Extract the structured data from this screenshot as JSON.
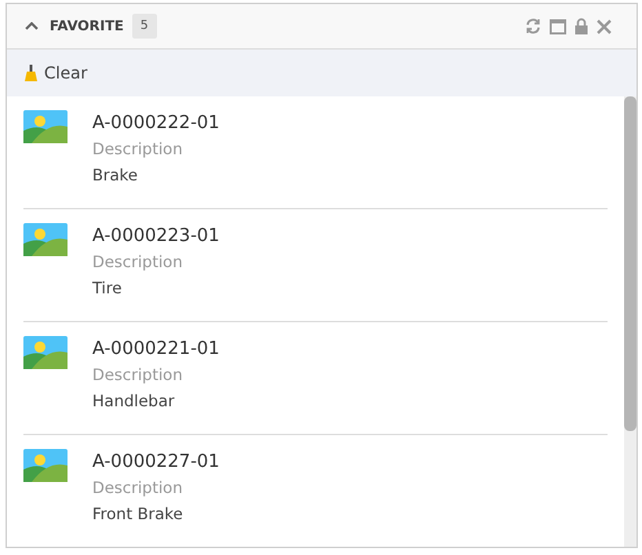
{
  "panel": {
    "title": "FAVORITE",
    "count": "5",
    "expanded": true
  },
  "toolbar": {
    "clear_label": "Clear"
  },
  "items": [
    {
      "code": "A-0000222-01",
      "field_label": "Description",
      "value": "Brake"
    },
    {
      "code": "A-0000223-01",
      "field_label": "Description",
      "value": "Tire"
    },
    {
      "code": "A-0000221-01",
      "field_label": "Description",
      "value": "Handlebar"
    },
    {
      "code": "A-0000227-01",
      "field_label": "Description",
      "value": "Front Brake"
    }
  ]
}
